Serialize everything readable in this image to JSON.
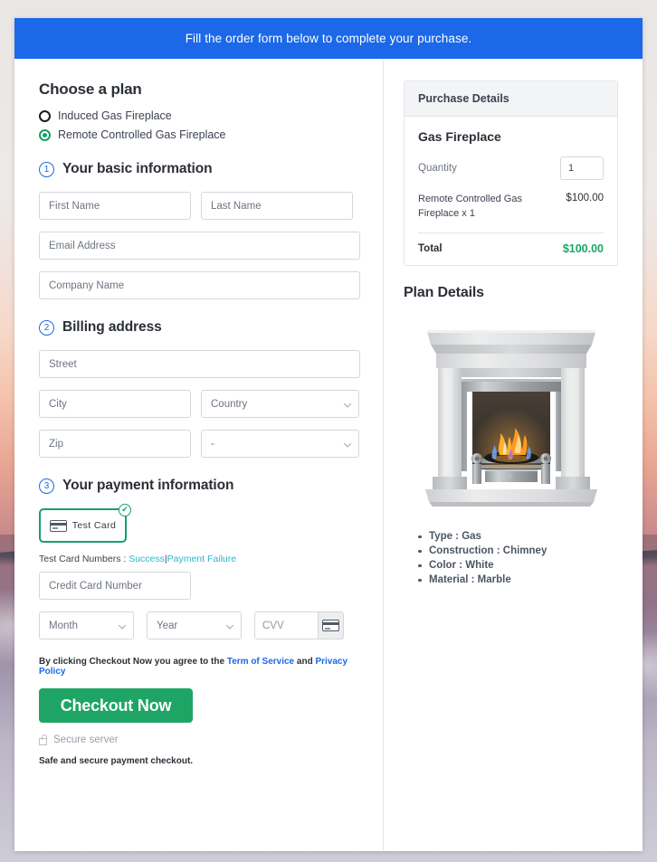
{
  "banner": {
    "text": "Fill the order form below to complete your purchase."
  },
  "plan": {
    "heading": "Choose a plan",
    "options": [
      {
        "label": "Induced Gas Fireplace",
        "selected": false
      },
      {
        "label": "Remote Controlled Gas Fireplace",
        "selected": true
      }
    ]
  },
  "steps": {
    "basic": {
      "number": "1",
      "title": "Your basic information"
    },
    "billing": {
      "number": "2",
      "title": "Billing address"
    },
    "payment": {
      "number": "3",
      "title": "Your payment information"
    }
  },
  "basic_fields": {
    "first_name": {
      "placeholder": "First Name",
      "value": ""
    },
    "last_name": {
      "placeholder": "Last Name",
      "value": ""
    },
    "email": {
      "placeholder": "Email Address",
      "value": ""
    },
    "company": {
      "placeholder": "Company Name",
      "value": ""
    }
  },
  "billing_fields": {
    "street": {
      "placeholder": "Street",
      "value": ""
    },
    "city": {
      "placeholder": "City",
      "value": ""
    },
    "country": {
      "selected": "Country"
    },
    "zip": {
      "placeholder": "Zip",
      "value": ""
    },
    "state": {
      "selected": "-"
    }
  },
  "payment": {
    "method_tile": {
      "label": "Test  Card",
      "icon": "credit-card-icon",
      "check_badge": "✔",
      "selected": true
    },
    "test_numbers_prefix": "Test Card Numbers :",
    "test_numbers_success": "Success",
    "test_numbers_separator": "|",
    "test_numbers_failure": "Payment Failure",
    "card_number": {
      "placeholder": "Credit Card Number",
      "value": ""
    },
    "month": {
      "selected": "Month"
    },
    "year": {
      "selected": "Year"
    },
    "cvv": {
      "placeholder": "CVV",
      "value": ""
    }
  },
  "footer": {
    "terms_prefix": "By clicking Checkout Now you agree to the",
    "terms_link": "Term of Service",
    "terms_and": "and",
    "privacy_link": "Privacy Policy",
    "checkout_label": "Checkout Now",
    "secure_server": "Secure server",
    "safe_text": "Safe and secure payment checkout."
  },
  "purchase": {
    "header": "Purchase Details",
    "product_name": "Gas Fireplace",
    "quantity_label": "Quantity",
    "quantity_value": "1",
    "line_item_desc": "Remote Controlled Gas Fireplace x 1",
    "line_item_price": "$100.00",
    "total_label": "Total",
    "total_value": "$100.00"
  },
  "plan_details": {
    "heading": "Plan Details",
    "image_alt": "marble-gas-fireplace-photo",
    "specs": [
      "Type : Gas",
      "Construction : Chimney",
      "Color : White",
      "Material : Marble"
    ]
  },
  "colors": {
    "banner_blue": "#1b68e8",
    "accent_green": "#1ea565",
    "radio_green": "#16a06a",
    "link_teal": "#2cb6cc",
    "link_blue": "#1b68e8"
  }
}
